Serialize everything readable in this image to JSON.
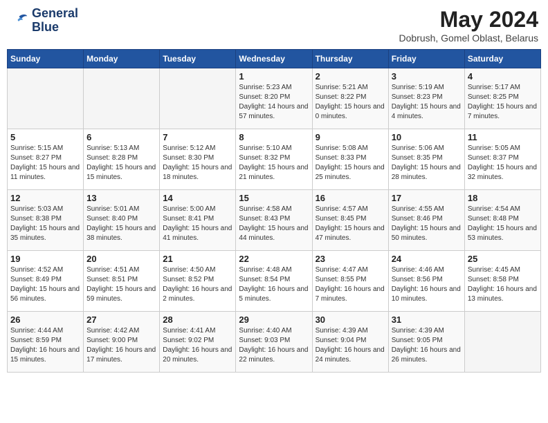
{
  "header": {
    "logo_line1": "General",
    "logo_line2": "Blue",
    "month_title": "May 2024",
    "subtitle": "Dobrush, Gomel Oblast, Belarus"
  },
  "weekdays": [
    "Sunday",
    "Monday",
    "Tuesday",
    "Wednesday",
    "Thursday",
    "Friday",
    "Saturday"
  ],
  "weeks": [
    [
      {
        "day": "",
        "sunrise": "",
        "sunset": "",
        "daylight": ""
      },
      {
        "day": "",
        "sunrise": "",
        "sunset": "",
        "daylight": ""
      },
      {
        "day": "",
        "sunrise": "",
        "sunset": "",
        "daylight": ""
      },
      {
        "day": "1",
        "sunrise": "Sunrise: 5:23 AM",
        "sunset": "Sunset: 8:20 PM",
        "daylight": "Daylight: 14 hours and 57 minutes."
      },
      {
        "day": "2",
        "sunrise": "Sunrise: 5:21 AM",
        "sunset": "Sunset: 8:22 PM",
        "daylight": "Daylight: 15 hours and 0 minutes."
      },
      {
        "day": "3",
        "sunrise": "Sunrise: 5:19 AM",
        "sunset": "Sunset: 8:23 PM",
        "daylight": "Daylight: 15 hours and 4 minutes."
      },
      {
        "day": "4",
        "sunrise": "Sunrise: 5:17 AM",
        "sunset": "Sunset: 8:25 PM",
        "daylight": "Daylight: 15 hours and 7 minutes."
      }
    ],
    [
      {
        "day": "5",
        "sunrise": "Sunrise: 5:15 AM",
        "sunset": "Sunset: 8:27 PM",
        "daylight": "Daylight: 15 hours and 11 minutes."
      },
      {
        "day": "6",
        "sunrise": "Sunrise: 5:13 AM",
        "sunset": "Sunset: 8:28 PM",
        "daylight": "Daylight: 15 hours and 15 minutes."
      },
      {
        "day": "7",
        "sunrise": "Sunrise: 5:12 AM",
        "sunset": "Sunset: 8:30 PM",
        "daylight": "Daylight: 15 hours and 18 minutes."
      },
      {
        "day": "8",
        "sunrise": "Sunrise: 5:10 AM",
        "sunset": "Sunset: 8:32 PM",
        "daylight": "Daylight: 15 hours and 21 minutes."
      },
      {
        "day": "9",
        "sunrise": "Sunrise: 5:08 AM",
        "sunset": "Sunset: 8:33 PM",
        "daylight": "Daylight: 15 hours and 25 minutes."
      },
      {
        "day": "10",
        "sunrise": "Sunrise: 5:06 AM",
        "sunset": "Sunset: 8:35 PM",
        "daylight": "Daylight: 15 hours and 28 minutes."
      },
      {
        "day": "11",
        "sunrise": "Sunrise: 5:05 AM",
        "sunset": "Sunset: 8:37 PM",
        "daylight": "Daylight: 15 hours and 32 minutes."
      }
    ],
    [
      {
        "day": "12",
        "sunrise": "Sunrise: 5:03 AM",
        "sunset": "Sunset: 8:38 PM",
        "daylight": "Daylight: 15 hours and 35 minutes."
      },
      {
        "day": "13",
        "sunrise": "Sunrise: 5:01 AM",
        "sunset": "Sunset: 8:40 PM",
        "daylight": "Daylight: 15 hours and 38 minutes."
      },
      {
        "day": "14",
        "sunrise": "Sunrise: 5:00 AM",
        "sunset": "Sunset: 8:41 PM",
        "daylight": "Daylight: 15 hours and 41 minutes."
      },
      {
        "day": "15",
        "sunrise": "Sunrise: 4:58 AM",
        "sunset": "Sunset: 8:43 PM",
        "daylight": "Daylight: 15 hours and 44 minutes."
      },
      {
        "day": "16",
        "sunrise": "Sunrise: 4:57 AM",
        "sunset": "Sunset: 8:45 PM",
        "daylight": "Daylight: 15 hours and 47 minutes."
      },
      {
        "day": "17",
        "sunrise": "Sunrise: 4:55 AM",
        "sunset": "Sunset: 8:46 PM",
        "daylight": "Daylight: 15 hours and 50 minutes."
      },
      {
        "day": "18",
        "sunrise": "Sunrise: 4:54 AM",
        "sunset": "Sunset: 8:48 PM",
        "daylight": "Daylight: 15 hours and 53 minutes."
      }
    ],
    [
      {
        "day": "19",
        "sunrise": "Sunrise: 4:52 AM",
        "sunset": "Sunset: 8:49 PM",
        "daylight": "Daylight: 15 hours and 56 minutes."
      },
      {
        "day": "20",
        "sunrise": "Sunrise: 4:51 AM",
        "sunset": "Sunset: 8:51 PM",
        "daylight": "Daylight: 15 hours and 59 minutes."
      },
      {
        "day": "21",
        "sunrise": "Sunrise: 4:50 AM",
        "sunset": "Sunset: 8:52 PM",
        "daylight": "Daylight: 16 hours and 2 minutes."
      },
      {
        "day": "22",
        "sunrise": "Sunrise: 4:48 AM",
        "sunset": "Sunset: 8:54 PM",
        "daylight": "Daylight: 16 hours and 5 minutes."
      },
      {
        "day": "23",
        "sunrise": "Sunrise: 4:47 AM",
        "sunset": "Sunset: 8:55 PM",
        "daylight": "Daylight: 16 hours and 7 minutes."
      },
      {
        "day": "24",
        "sunrise": "Sunrise: 4:46 AM",
        "sunset": "Sunset: 8:56 PM",
        "daylight": "Daylight: 16 hours and 10 minutes."
      },
      {
        "day": "25",
        "sunrise": "Sunrise: 4:45 AM",
        "sunset": "Sunset: 8:58 PM",
        "daylight": "Daylight: 16 hours and 13 minutes."
      }
    ],
    [
      {
        "day": "26",
        "sunrise": "Sunrise: 4:44 AM",
        "sunset": "Sunset: 8:59 PM",
        "daylight": "Daylight: 16 hours and 15 minutes."
      },
      {
        "day": "27",
        "sunrise": "Sunrise: 4:42 AM",
        "sunset": "Sunset: 9:00 PM",
        "daylight": "Daylight: 16 hours and 17 minutes."
      },
      {
        "day": "28",
        "sunrise": "Sunrise: 4:41 AM",
        "sunset": "Sunset: 9:02 PM",
        "daylight": "Daylight: 16 hours and 20 minutes."
      },
      {
        "day": "29",
        "sunrise": "Sunrise: 4:40 AM",
        "sunset": "Sunset: 9:03 PM",
        "daylight": "Daylight: 16 hours and 22 minutes."
      },
      {
        "day": "30",
        "sunrise": "Sunrise: 4:39 AM",
        "sunset": "Sunset: 9:04 PM",
        "daylight": "Daylight: 16 hours and 24 minutes."
      },
      {
        "day": "31",
        "sunrise": "Sunrise: 4:39 AM",
        "sunset": "Sunset: 9:05 PM",
        "daylight": "Daylight: 16 hours and 26 minutes."
      },
      {
        "day": "",
        "sunrise": "",
        "sunset": "",
        "daylight": ""
      }
    ]
  ]
}
